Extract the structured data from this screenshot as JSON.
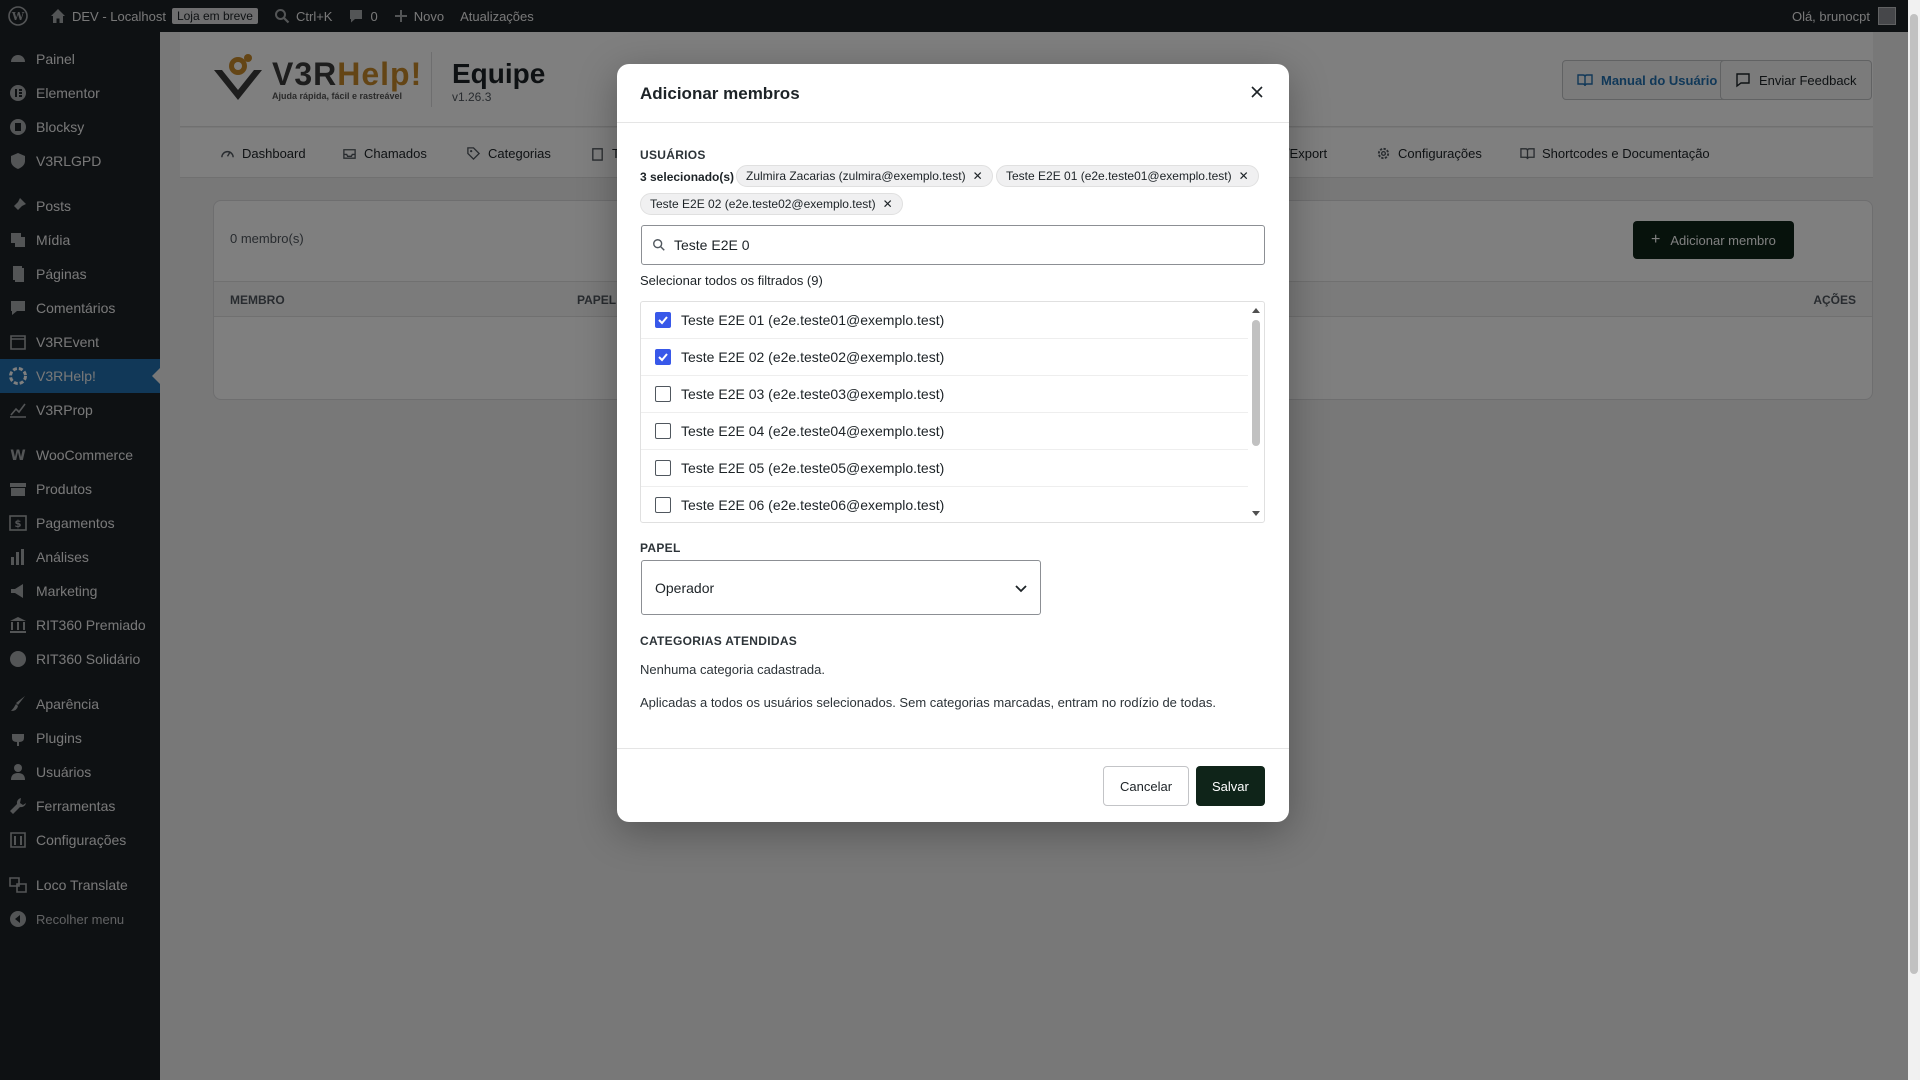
{
  "adminbar": {
    "site_name": "DEV - Localhost",
    "store_badge": "Loja em breve",
    "search_shortcut": "Ctrl+K",
    "comments_count": "0",
    "new_label": "Novo",
    "updates_label": "Atualizações",
    "greeting": "Olá, brunocpt"
  },
  "sidebar": {
    "items": [
      {
        "label": "Painel",
        "icon": "dashboard-icon"
      },
      {
        "label": "Elementor",
        "icon": "elementor-icon"
      },
      {
        "label": "Blocksy",
        "icon": "blocksy-icon"
      },
      {
        "label": "V3RLGPD",
        "icon": "shield-icon"
      },
      {
        "label": "Posts",
        "icon": "pin-icon"
      },
      {
        "label": "Mídia",
        "icon": "media-icon"
      },
      {
        "label": "Páginas",
        "icon": "pages-icon"
      },
      {
        "label": "Comentários",
        "icon": "comment-icon"
      },
      {
        "label": "V3REvent",
        "icon": "calendar-icon"
      },
      {
        "label": "V3RHelp!",
        "icon": "help-icon"
      },
      {
        "label": "V3RProp",
        "icon": "chart-icon"
      },
      {
        "label": "WooCommerce",
        "icon": "woo-icon"
      },
      {
        "label": "Produtos",
        "icon": "archive-icon"
      },
      {
        "label": "Pagamentos",
        "icon": "money-icon"
      },
      {
        "label": "Análises",
        "icon": "bar-chart-icon"
      },
      {
        "label": "Marketing",
        "icon": "megaphone-icon"
      },
      {
        "label": "RIT360 Premiado",
        "icon": "bank-icon"
      },
      {
        "label": "RIT360 Solidário",
        "icon": "circle-icon"
      },
      {
        "label": "Aparência",
        "icon": "brush-icon"
      },
      {
        "label": "Plugins",
        "icon": "plugin-icon"
      },
      {
        "label": "Usuários",
        "icon": "user-icon"
      },
      {
        "label": "Ferramentas",
        "icon": "wrench-icon"
      },
      {
        "label": "Configurações",
        "icon": "settings-icon"
      },
      {
        "label": "Loco Translate",
        "icon": "translate-icon"
      },
      {
        "label": "Recolher menu",
        "icon": "collapse-icon"
      }
    ]
  },
  "header": {
    "logo_word_a": "V3R",
    "logo_word_b": "Help!",
    "logo_tagline": "Ajuda rápida, fácil e rastreável",
    "title": "Equipe",
    "version": "v1.26.3",
    "manual_label": "Manual do Usuário",
    "feedback_label": "Enviar Feedback"
  },
  "tabs": [
    {
      "label": "Dashboard"
    },
    {
      "label": "Chamados"
    },
    {
      "label": "Categorias"
    },
    {
      "label": "T"
    },
    {
      "label": "rt/Export"
    },
    {
      "label": "Configurações"
    },
    {
      "label": "Shortcodes e Documentação"
    }
  ],
  "members": {
    "count_label": "0 membro(s)",
    "add_label": "Adicionar membro",
    "col_member": "MEMBRO",
    "col_role": "PAPEL",
    "col_actions": "AÇÕES"
  },
  "modal": {
    "title": "Adicionar membros",
    "users_label": "USUÁRIOS",
    "selected_count": "3 selecionado(s)",
    "chips": [
      "Zulmira Zacarias (zulmira@exemplo.test)",
      "Teste E2E 01 (e2e.teste01@exemplo.test)",
      "Teste E2E 02 (e2e.teste02@exemplo.test)"
    ],
    "search_value": "Teste E2E 0",
    "select_all_label": "Selecionar todos os filtrados (9)",
    "users": [
      {
        "label": "Teste E2E 01 (e2e.teste01@exemplo.test)",
        "checked": true
      },
      {
        "label": "Teste E2E 02 (e2e.teste02@exemplo.test)",
        "checked": true
      },
      {
        "label": "Teste E2E 03 (e2e.teste03@exemplo.test)",
        "checked": false
      },
      {
        "label": "Teste E2E 04 (e2e.teste04@exemplo.test)",
        "checked": false
      },
      {
        "label": "Teste E2E 05 (e2e.teste05@exemplo.test)",
        "checked": false
      },
      {
        "label": "Teste E2E 06 (e2e.teste06@exemplo.test)",
        "checked": false
      }
    ],
    "role_label": "PAPEL",
    "role_value": "Operador",
    "categories_label": "CATEGORIAS ATENDIDAS",
    "no_categories": "Nenhuma categoria cadastrada.",
    "help_text": "Aplicadas a todos os usuários selecionados. Sem categorias marcadas, entram no rodízio de todas.",
    "cancel_label": "Cancelar",
    "save_label": "Salvar"
  },
  "colors": {
    "admin_dark": "#1d2327",
    "active_blue": "#2271b1",
    "primary_dark": "#0f2419",
    "checkbox_blue": "#3858e9",
    "logo_orange": "#c98a2a"
  }
}
